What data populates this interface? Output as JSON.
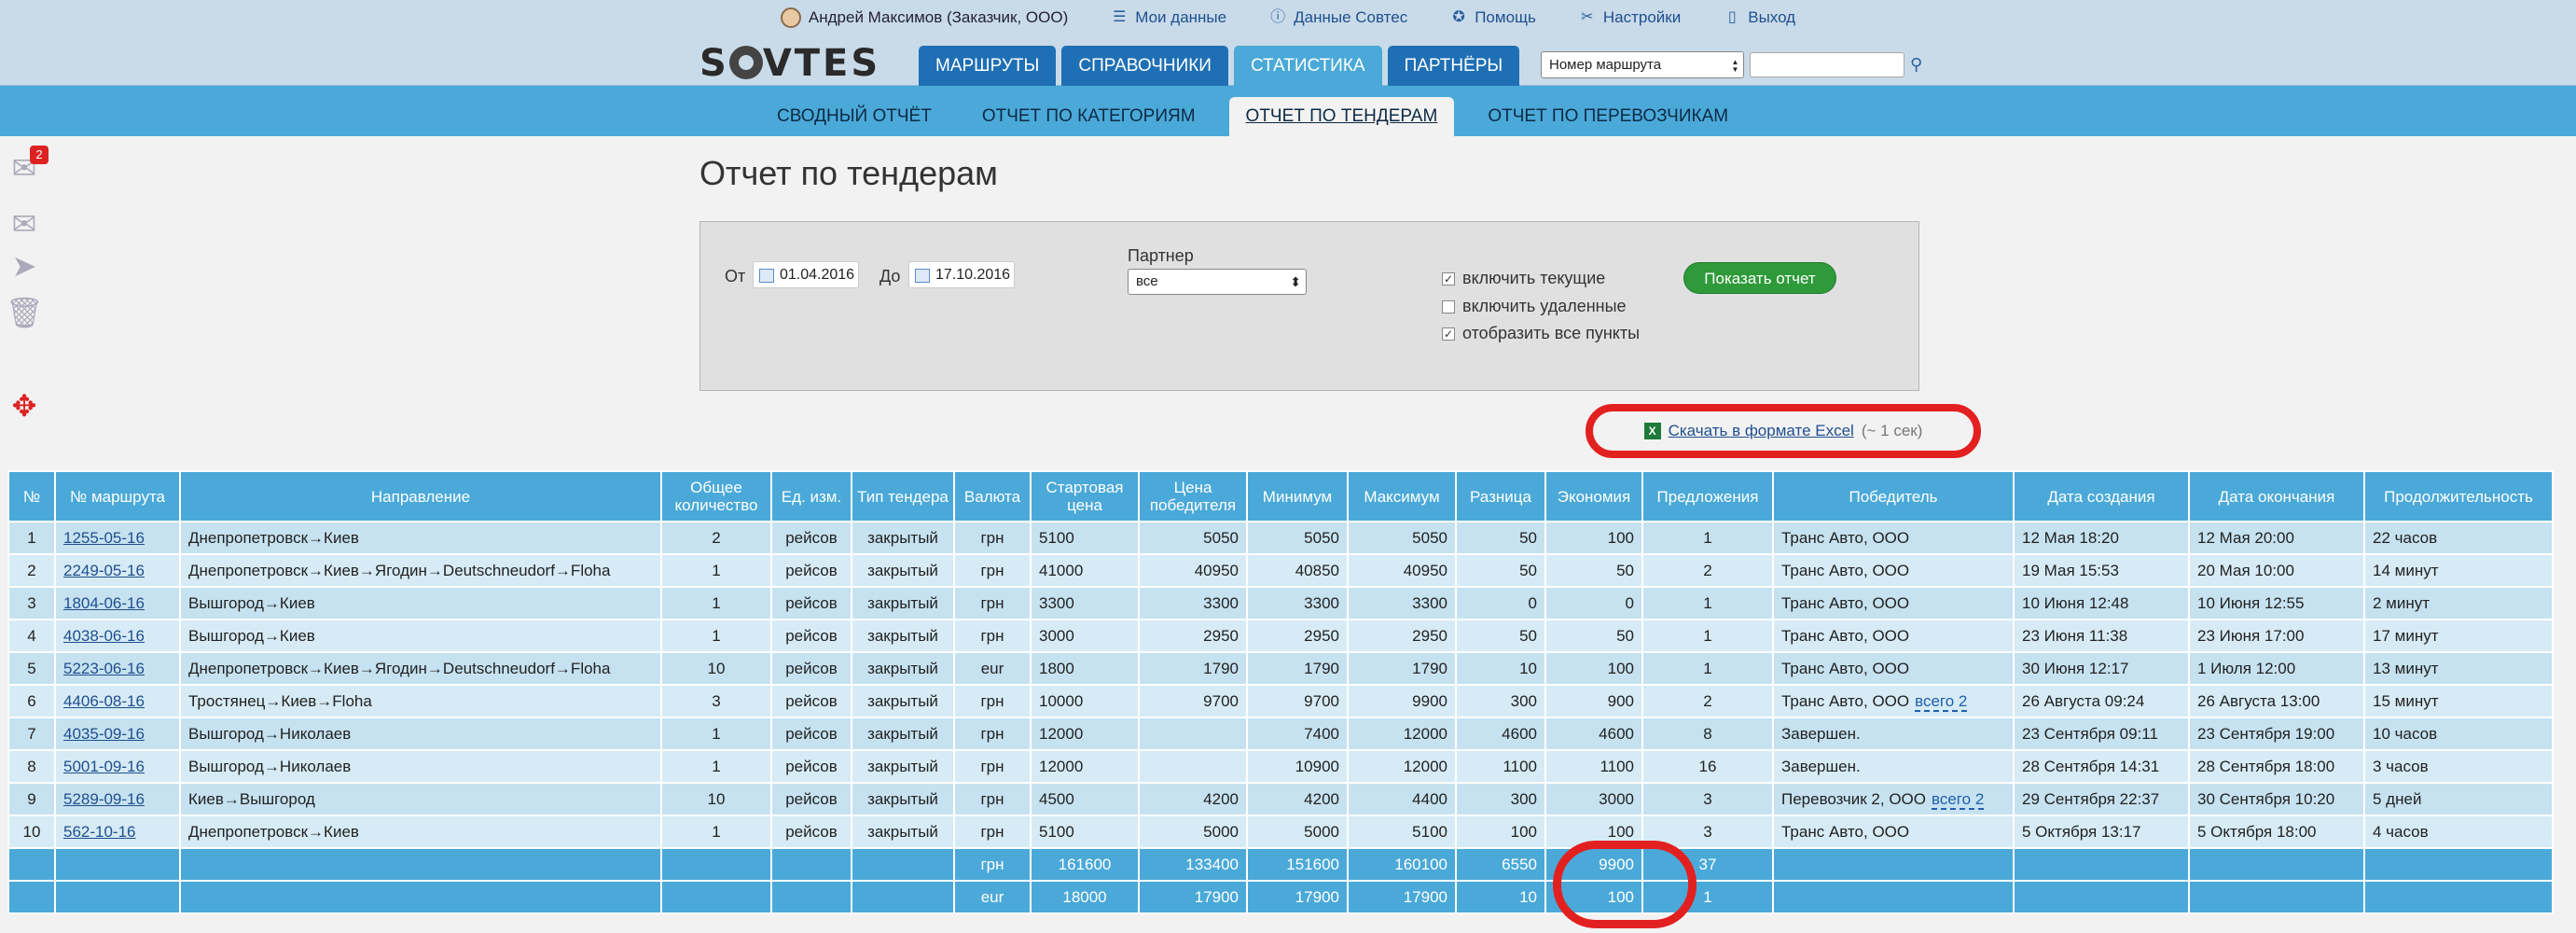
{
  "userbar": {
    "user": "Андрей Максимов (Заказчик, ООО)",
    "my_data": "Мои данные",
    "sovtes_data": "Данные Совтес",
    "help": "Помощь",
    "settings": "Настройки",
    "logout": "Выход"
  },
  "header": {
    "logo": "SOVTES",
    "tabs": [
      "МАРШРУТЫ",
      "СПРАВОЧНИКИ",
      "СТАТИСТИКА",
      "ПАРТНЁРЫ"
    ],
    "search_select": "Номер маршрута",
    "search_placeholder": ""
  },
  "subnav": {
    "tabs": [
      "СВОДНЫЙ ОТЧЁТ",
      "ОТЧЕТ ПО КАТЕГОРИЯМ",
      "ОТЧЕТ ПО ТЕНДЕРАМ",
      "ОТЧЕТ ПО ПЕРЕВОЗЧИКАМ"
    ]
  },
  "sidebar": {
    "inbox_count": "2"
  },
  "page": {
    "title": "Отчет по тендерам"
  },
  "filter": {
    "from_label": "От",
    "from_value": "01.04.2016",
    "to_label": "До",
    "to_value": "17.10.2016",
    "partner_label": "Партнер",
    "partner_value": "все",
    "chk_current": "включить текущие",
    "chk_deleted": "включить удаленные",
    "chk_all_points": "отобразить все пункты",
    "show_button": "Показать отчет"
  },
  "excel": {
    "link": "Скачать в формате Excel",
    "hint": "(~ 1 сек)"
  },
  "table": {
    "headers": [
      "№",
      "№ маршрута",
      "Направление",
      "Общее количество",
      "Ед. изм.",
      "Тип тендера",
      "Валюта",
      "Стартовая цена",
      "Цена победителя",
      "Минимум",
      "Максимум",
      "Разница",
      "Экономия",
      "Предложения",
      "Победитель",
      "Дата создания",
      "Дата окончания",
      "Продолжительность"
    ],
    "rows": [
      {
        "n": "1",
        "route": "1255-05-16",
        "dir": "Днепропетровск→Киев",
        "qty": "2",
        "unit": "рейсов",
        "type": "закрытый",
        "cur": "грн",
        "start": "5100",
        "win": "5050",
        "min": "5050",
        "max": "5050",
        "diff": "50",
        "econ": "100",
        "offers": "1",
        "winner": "Транс Авто, ООО",
        "more": "",
        "created": "12 Мая 18:20",
        "end": "12 Мая 20:00",
        "dur": "22 часов"
      },
      {
        "n": "2",
        "route": "2249-05-16",
        "dir": "Днепропетровск→Киев→Ягодин→Deutschneudorf→Floha",
        "qty": "1",
        "unit": "рейсов",
        "type": "закрытый",
        "cur": "грн",
        "start": "41000",
        "win": "40950",
        "min": "40850",
        "max": "40950",
        "diff": "50",
        "econ": "50",
        "offers": "2",
        "winner": "Транс Авто, ООО",
        "more": "",
        "created": "19 Мая 15:53",
        "end": "20 Мая 10:00",
        "dur": "14 минут"
      },
      {
        "n": "3",
        "route": "1804-06-16",
        "dir": "Вышгород→Киев",
        "qty": "1",
        "unit": "рейсов",
        "type": "закрытый",
        "cur": "грн",
        "start": "3300",
        "win": "3300",
        "min": "3300",
        "max": "3300",
        "diff": "0",
        "econ": "0",
        "offers": "1",
        "winner": "Транс Авто, ООО",
        "more": "",
        "created": "10 Июня 12:48",
        "end": "10 Июня 12:55",
        "dur": "2 минут"
      },
      {
        "n": "4",
        "route": "4038-06-16",
        "dir": "Вышгород→Киев",
        "qty": "1",
        "unit": "рейсов",
        "type": "закрытый",
        "cur": "грн",
        "start": "3000",
        "win": "2950",
        "min": "2950",
        "max": "2950",
        "diff": "50",
        "econ": "50",
        "offers": "1",
        "winner": "Транс Авто, ООО",
        "more": "",
        "created": "23 Июня 11:38",
        "end": "23 Июня 17:00",
        "dur": "17 минут"
      },
      {
        "n": "5",
        "route": "5223-06-16",
        "dir": "Днепропетровск→Киев→Ягодин→Deutschneudorf→Floha",
        "qty": "10",
        "unit": "рейсов",
        "type": "закрытый",
        "cur": "eur",
        "start": "1800",
        "win": "1790",
        "min": "1790",
        "max": "1790",
        "diff": "10",
        "econ": "100",
        "offers": "1",
        "winner": "Транс Авто, ООО",
        "more": "",
        "created": "30 Июня 12:17",
        "end": "1 Июля 12:00",
        "dur": "13 минут"
      },
      {
        "n": "6",
        "route": "4406-08-16",
        "dir": "Тростянец→Киев→Floha",
        "qty": "3",
        "unit": "рейсов",
        "type": "закрытый",
        "cur": "грн",
        "start": "10000",
        "win": "9700",
        "min": "9700",
        "max": "9900",
        "diff": "300",
        "econ": "900",
        "offers": "2",
        "winner": "Транс Авто, ООО",
        "more": "всего 2",
        "created": "26 Августа 09:24",
        "end": "26 Августа 13:00",
        "dur": "15 минут"
      },
      {
        "n": "7",
        "route": "4035-09-16",
        "dir": "Вышгород→Николаев",
        "qty": "1",
        "unit": "рейсов",
        "type": "закрытый",
        "cur": "грн",
        "start": "12000",
        "win": "",
        "min": "7400",
        "max": "12000",
        "diff": "4600",
        "econ": "4600",
        "offers": "8",
        "winner": "Завершен.",
        "more": "",
        "created": "23 Сентября 09:11",
        "end": "23 Сентября 19:00",
        "dur": "10 часов"
      },
      {
        "n": "8",
        "route": "5001-09-16",
        "dir": "Вышгород→Николаев",
        "qty": "1",
        "unit": "рейсов",
        "type": "закрытый",
        "cur": "грн",
        "start": "12000",
        "win": "",
        "min": "10900",
        "max": "12000",
        "diff": "1100",
        "econ": "1100",
        "offers": "16",
        "winner": "Завершен.",
        "more": "",
        "created": "28 Сентября 14:31",
        "end": "28 Сентября 18:00",
        "dur": "3 часов"
      },
      {
        "n": "9",
        "route": "5289-09-16",
        "dir": "Киев→Вышгород",
        "qty": "10",
        "unit": "рейсов",
        "type": "закрытый",
        "cur": "грн",
        "start": "4500",
        "win": "4200",
        "min": "4200",
        "max": "4400",
        "diff": "300",
        "econ": "3000",
        "offers": "3",
        "winner": "Перевозчик 2, ООО",
        "more": "всего 2",
        "created": "29 Сентября 22:37",
        "end": "30 Сентября 10:20",
        "dur": "5 дней"
      },
      {
        "n": "10",
        "route": "562-10-16",
        "dir": "Днепропетровск→Киев",
        "qty": "1",
        "unit": "рейсов",
        "type": "закрытый",
        "cur": "грн",
        "start": "5100",
        "win": "5000",
        "min": "5000",
        "max": "5100",
        "diff": "100",
        "econ": "100",
        "offers": "3",
        "winner": "Транс Авто, ООО",
        "more": "",
        "created": "5 Октября 13:17",
        "end": "5 Октября 18:00",
        "dur": "4 часов"
      }
    ],
    "totals": [
      {
        "cur": "грн",
        "start": "161600",
        "win": "133400",
        "min": "151600",
        "max": "160100",
        "diff": "6550",
        "econ": "9900",
        "offers": "37"
      },
      {
        "cur": "eur",
        "start": "18000",
        "win": "17900",
        "min": "17900",
        "max": "17900",
        "diff": "10",
        "econ": "100",
        "offers": "1"
      }
    ]
  }
}
